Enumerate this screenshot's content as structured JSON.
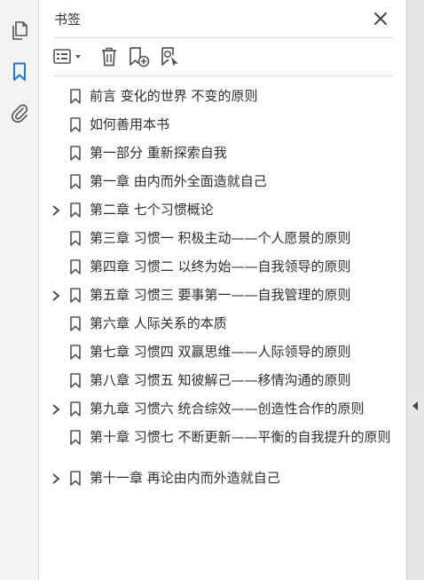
{
  "panel": {
    "title": "书签",
    "accent_color": "#1473e6"
  },
  "left_rail": {
    "items": [
      {
        "icon": "pages-icon"
      },
      {
        "icon": "bookmark-icon",
        "active": true
      },
      {
        "icon": "attachment-icon"
      }
    ]
  },
  "toolbar": {
    "items": [
      {
        "icon": "options-menu-icon"
      },
      {
        "icon": "delete-icon"
      },
      {
        "icon": "new-bookmark-icon"
      },
      {
        "icon": "bookmark-search-icon"
      }
    ]
  },
  "bookmarks": [
    {
      "label": "前言  变化的世界  不变的原则",
      "expandable": false
    },
    {
      "label": "如何善用本书",
      "expandable": false
    },
    {
      "label": "第一部分  重新探索自我",
      "expandable": false
    },
    {
      "label": "第一章  由内而外全面造就自己",
      "expandable": false
    },
    {
      "label": "第二章  七个习惯概论",
      "expandable": true
    },
    {
      "label": "第三章  习惯一  积极主动——个人愿景的原则",
      "expandable": false
    },
    {
      "label": "第四章  习惯二  以终为始——自我领导的原则",
      "expandable": false
    },
    {
      "label": "第五章  习惯三  要事第一——自我管理的原则",
      "expandable": true
    },
    {
      "label": "第六章  人际关系的本质",
      "expandable": false
    },
    {
      "label": "第七章  习惯四  双赢思维——人际领导的原则",
      "expandable": false
    },
    {
      "label": "第八章  习惯五  知彼解己——移情沟通的原则",
      "expandable": false
    },
    {
      "label": "第九章  习惯六  统合综效——创造性合作的原则",
      "expandable": true
    },
    {
      "label": "第十章  习惯七  不断更新——平衡的自我提升的原则",
      "expandable": false
    },
    {
      "label": "第十一章  再论由内而外造就自己",
      "expandable": true
    }
  ]
}
